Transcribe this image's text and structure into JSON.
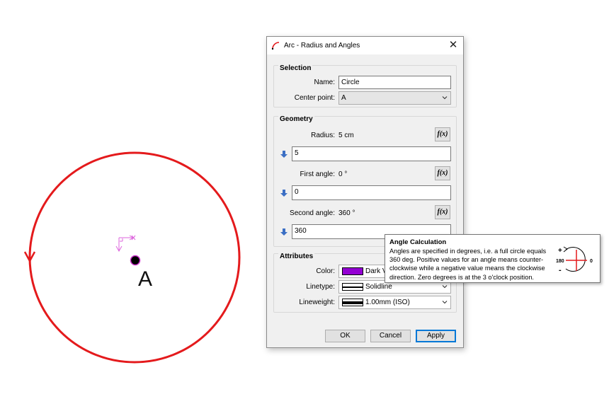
{
  "canvas": {
    "point_label": "A",
    "circle_color": "#e41a1c",
    "point_marker_color": "#cc33cc"
  },
  "dialog": {
    "title": "Arc - Radius and Angles",
    "close_icon": "close-icon",
    "selection": {
      "group_title": "Selection",
      "name_label": "Name:",
      "name_value": "Circle",
      "center_label": "Center point:",
      "center_value": "A"
    },
    "geometry": {
      "group_title": "Geometry",
      "radius_label": "Radius:",
      "radius_display": "5 cm",
      "radius_value": "5",
      "first_angle_label": "First angle:",
      "first_angle_display": "0 °",
      "first_angle_value": "0",
      "second_angle_label": "Second angle:",
      "second_angle_display": "360 °",
      "second_angle_value": "360",
      "fx_label": "f(x)"
    },
    "attributes": {
      "group_title": "Attributes",
      "color_label": "Color:",
      "color_value": "Dark V",
      "color_swatch": "#9400d3",
      "linetype_label": "Linetype:",
      "linetype_value": "Solidline",
      "lineweight_label": "Lineweight:",
      "lineweight_value": "1.00mm (ISO)"
    },
    "buttons": {
      "ok": "OK",
      "cancel": "Cancel",
      "apply": "Apply"
    }
  },
  "tooltip": {
    "title": "Angle Calculation",
    "text": "Angles are specified in degrees, i.e. a full circle equals 360 deg. Positive values for an angle means counter-clockwise while a negative value means the clockwise direction. Zero degrees is at the 3 o'clock position.",
    "diagram": {
      "plus": "+",
      "minus": "-",
      "left": "180",
      "right": "0"
    }
  }
}
